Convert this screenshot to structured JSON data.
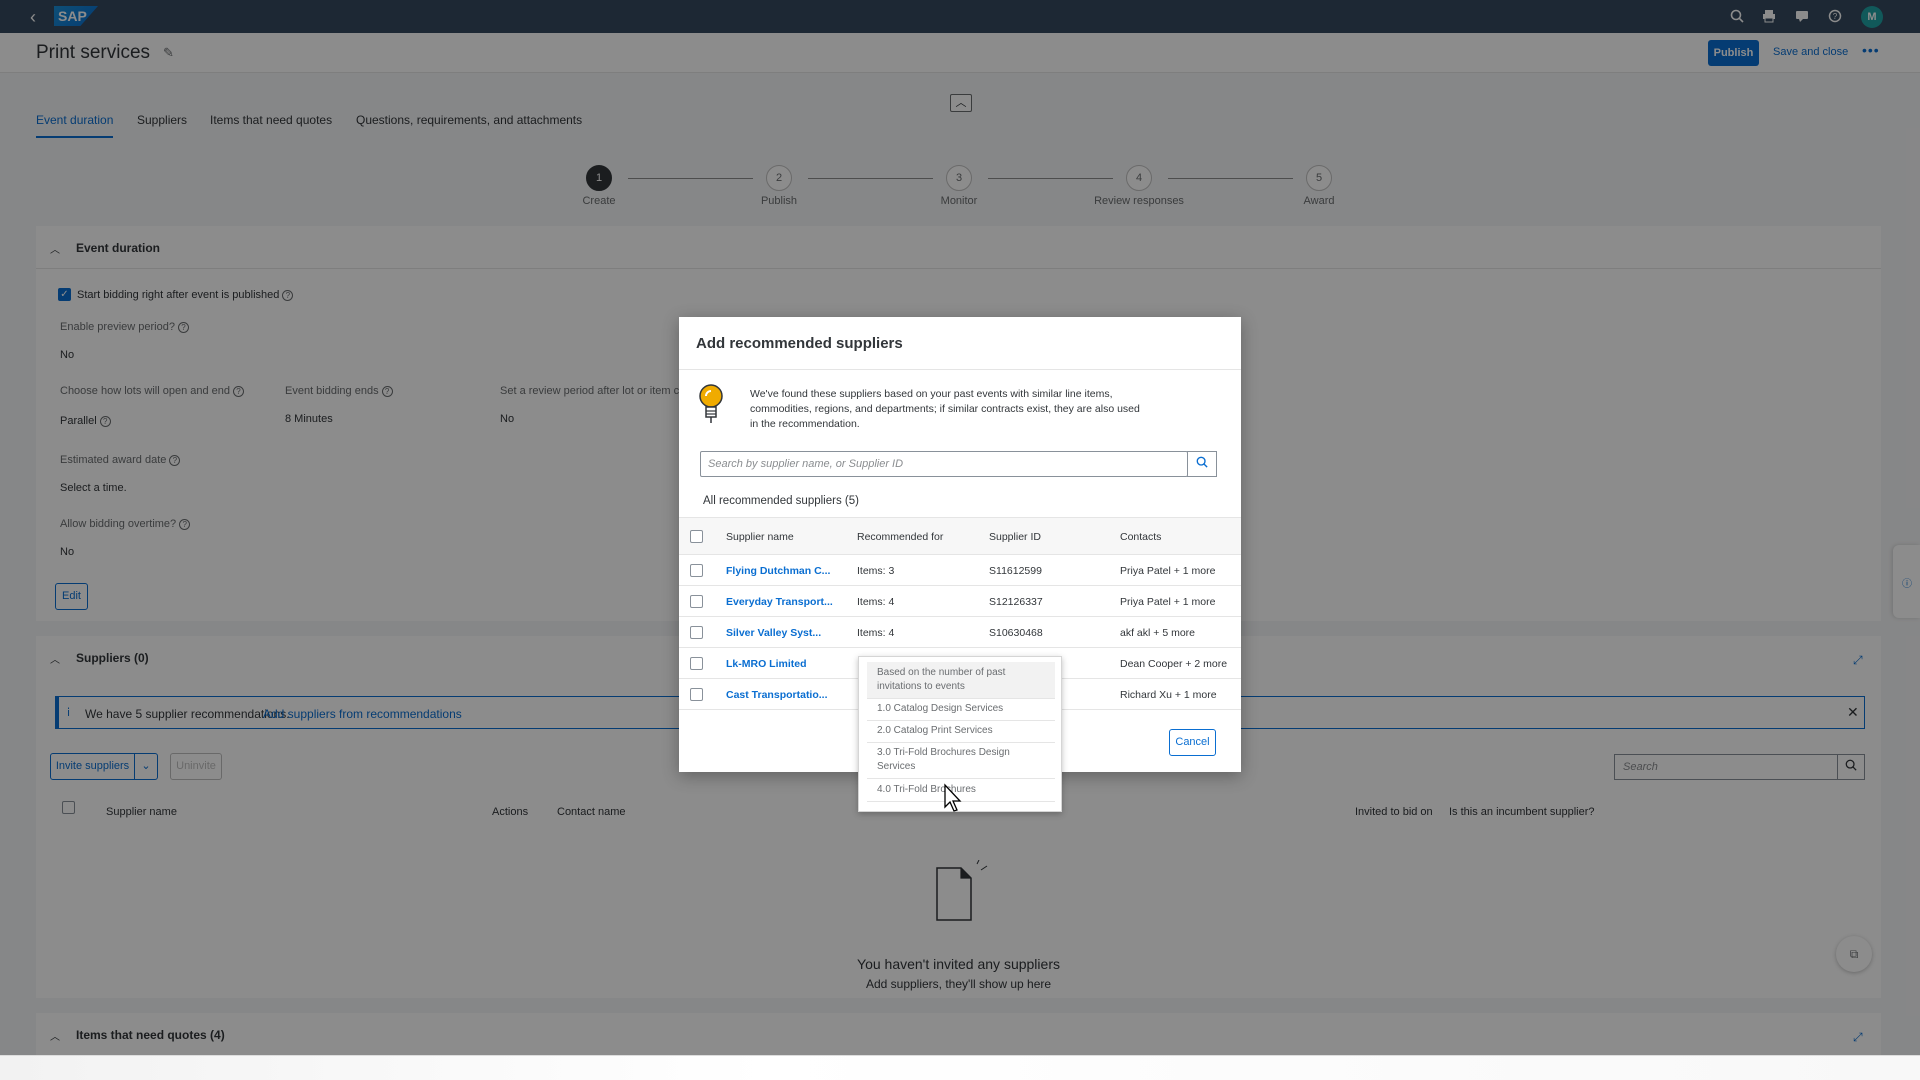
{
  "shell": {
    "logo": "SAP",
    "avatar_initial": "M"
  },
  "header": {
    "title": "Print services",
    "publish_label": "Publish",
    "save_close_label": "Save and close"
  },
  "tabs": [
    {
      "label": "Event duration"
    },
    {
      "label": "Suppliers"
    },
    {
      "label": "Items that need quotes"
    },
    {
      "label": "Questions, requirements, and attachments"
    }
  ],
  "steps": [
    {
      "num": "1",
      "label": "Create"
    },
    {
      "num": "2",
      "label": "Publish"
    },
    {
      "num": "3",
      "label": "Monitor"
    },
    {
      "num": "4",
      "label": "Review responses"
    },
    {
      "num": "5",
      "label": "Award"
    }
  ],
  "event_duration": {
    "title": "Event duration",
    "start_bidding_label": "Start bidding right after event is published",
    "preview_label": "Enable preview period?",
    "preview_value": "No",
    "lots_label": "Choose how lots will open and end",
    "lots_value": "Parallel",
    "ends_label": "Event bidding ends",
    "ends_value": "8 Minutes",
    "review_label": "Set a review period after lot or item cl",
    "review_value": "No",
    "award_label": "Estimated award date",
    "award_value": "Select a time.",
    "overtime_label": "Allow bidding overtime?",
    "overtime_value": "No",
    "edit_label": "Edit"
  },
  "suppliers_section": {
    "title": "Suppliers (0)",
    "banner_text": "We have 5 supplier recommendations.",
    "banner_link": "Add suppliers from recommendations",
    "invite_label": "Invite suppliers",
    "uninvite_label": "Uninvite",
    "search_placeholder": "Search",
    "columns": [
      "Supplier name",
      "Actions",
      "Contact name",
      "Invited to bid on",
      "Is this an incumbent supplier?"
    ],
    "empty_title": "You haven't invited any suppliers",
    "empty_sub": "Add suppliers, they'll show up here"
  },
  "items_section": {
    "title": "Items that need quotes (4)"
  },
  "dialog": {
    "title": "Add recommended suppliers",
    "info": "We've found these suppliers based on your past events with similar line items, commodities, regions, and departments; if similar contracts exist, they are also used in the recommendation.",
    "search_placeholder": "Search by supplier name, or Supplier ID",
    "all_label": "All recommended suppliers (5)",
    "columns": [
      "Supplier name",
      "Recommended for",
      "Supplier ID",
      "Contacts"
    ],
    "rows": [
      {
        "name": "Flying Dutchman C...",
        "rec": "Items: 3",
        "id": "S11612599",
        "contacts": "Priya Patel + 1 more"
      },
      {
        "name": "Everyday Transport...",
        "rec": "Items: 4",
        "id": "S12126337",
        "contacts": "Priya Patel + 1 more"
      },
      {
        "name": "Silver Valley Syst...",
        "rec": "Items: 4",
        "id": "S10630468",
        "contacts": "akf akl + 5 more"
      },
      {
        "name": "Lk-MRO Limited",
        "rec": "",
        "id": "",
        "contacts": "Dean Cooper + 2 more"
      },
      {
        "name": "Cast Transportatio...",
        "rec": "",
        "id": "",
        "contacts": "Richard Xu + 1 more"
      }
    ],
    "cancel_label": "Cancel"
  },
  "popover": {
    "items": [
      "Based on the number of past invitations to events",
      "1.0 Catalog Design Services",
      "2.0 Catalog Print Services",
      "3.0 Tri-Fold Brochures Design Services",
      "4.0 Tri-Fold Brochures"
    ]
  }
}
